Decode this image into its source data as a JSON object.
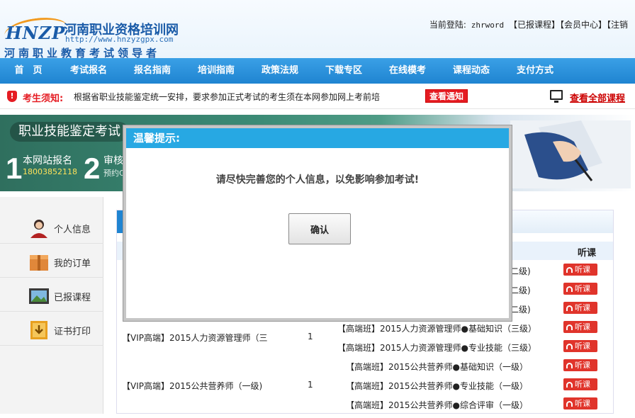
{
  "header": {
    "logo_mark": "HNZP",
    "site_name": "河南职业资格培训网",
    "site_url": "http://www.hnzyzgpx.com",
    "slogan": "河南职业教育考试领导者",
    "login_prefix": "当前登陆:",
    "username": "zhrword",
    "links": [
      "【已报课程】",
      "【会员中心】",
      "【注销"
    ]
  },
  "nav": {
    "items": [
      "首　页",
      "考试报名",
      "报名指南",
      "培训指南",
      "政策法规",
      "下载专区",
      "在线模考",
      "课程动态",
      "支付方式"
    ]
  },
  "notice": {
    "label": "考生须知:",
    "text": "根据省职业技能鉴定统一安排，要求参加正式考试的考生须在本网参加网上考前培",
    "button": "查看通知",
    "all_courses": "查看全部课程",
    "colors": {
      "alert": "#e51c23"
    }
  },
  "banner": {
    "title": "职业技能鉴定考试",
    "step1_num": "1",
    "step1_label": "本网站报名",
    "step1_phone": "18003852118",
    "step2_num": "2",
    "step2_label": "审核",
    "step2_sub": "预约C"
  },
  "sidebar": {
    "items": [
      {
        "label": "个人信息",
        "icon": "user-avatar-icon"
      },
      {
        "label": "我的订单",
        "icon": "order-box-icon"
      },
      {
        "label": "已报课程",
        "icon": "course-picture-icon"
      },
      {
        "label": "证书打印",
        "icon": "certificate-download-icon"
      }
    ]
  },
  "table": {
    "listen_header": "听课",
    "listen_label": "听课",
    "rows": [
      {
        "course": "",
        "qty": "",
        "sub": "二级)"
      },
      {
        "course": "",
        "qty": "",
        "sub": "二级)"
      },
      {
        "course": "",
        "qty": "",
        "sub": "二级)"
      },
      {
        "course": "",
        "qty": "",
        "sub": "【高端班】2015人力资源管理师●基础知识（三级）"
      },
      {
        "course": "【VIP高端】2015人力资源管理师（三",
        "qty": "1",
        "sub": "【高端班】2015人力资源管理师●专业技能（三级）"
      },
      {
        "course": "",
        "qty": "",
        "sub": "【高端班】2015公共营养师●基础知识（一级）"
      },
      {
        "course": "【VIP高端】2015公共营养师（一级)",
        "qty": "1",
        "sub": "【高端班】2015公共营养师●专业技能（一级）"
      },
      {
        "course": "",
        "qty": "",
        "sub": "【高端班】2015公共营养师●综合评审（一级）"
      }
    ]
  },
  "modal": {
    "title": "温馨提示:",
    "message": "请尽快完善您的个人信息，以免影响参加考试!",
    "ok_label": "确认"
  }
}
